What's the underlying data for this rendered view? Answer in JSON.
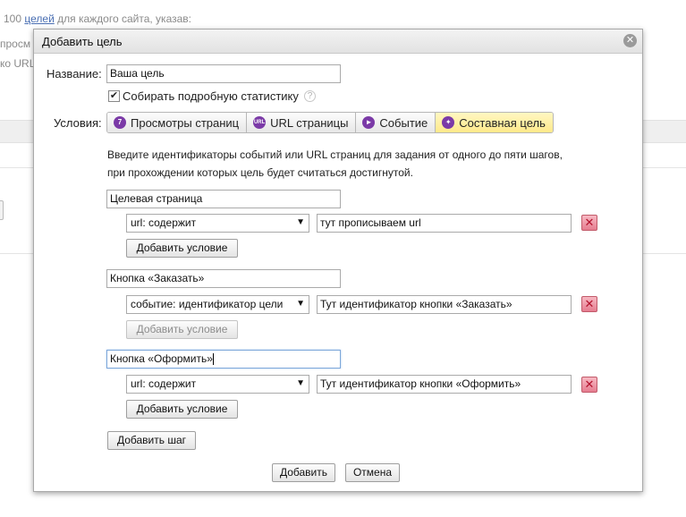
{
  "background": {
    "line1_prefix": "100",
    "line1_link": "целей",
    "line1_suffix": "для каждого сайта, указав:",
    "line2": "просм",
    "line3": "ко URL"
  },
  "dialog": {
    "title": "Добавить цель",
    "close_icon": "close-icon",
    "name_label": "Название:",
    "name_value": "Ваша цель",
    "detailed_stats_label": "Собирать подробную статистику",
    "detailed_stats_checked": true,
    "help_glyph": "?",
    "conditions_label": "Условия:",
    "tabs": [
      {
        "label": "Просмотры страниц",
        "icon": "pageviews-icon",
        "glyph": "7",
        "active": false
      },
      {
        "label": "URL страницы",
        "icon": "url-icon",
        "glyph": "URL",
        "active": false
      },
      {
        "label": "Событие",
        "icon": "event-icon",
        "glyph": "►",
        "active": false
      },
      {
        "label": "Составная цель",
        "icon": "composite-icon",
        "glyph": "✦",
        "active": true
      }
    ],
    "info_line1": "Введите идентификаторы событий или URL страниц для задания от одного до пяти шагов,",
    "info_line2": "при прохождении которых цель будет считаться достигнутой.",
    "steps": [
      {
        "name": "Целевая страница",
        "condition_type": "url: содержит",
        "condition_value": "тут прописываем url",
        "add_condition_label": "Добавить условие",
        "add_condition_disabled": false
      },
      {
        "name": "Кнопка «Заказать»",
        "condition_type": "событие: идентификатор цели",
        "condition_value": "Тут идентификатор кнопки «Заказать»",
        "add_condition_label": "Добавить условие",
        "add_condition_disabled": true
      },
      {
        "name": "Кнопка «Оформить»",
        "condition_type": "url: содержит",
        "condition_value": "Тут идентификатор кнопки «Оформить»",
        "add_condition_label": "Добавить условие",
        "add_condition_disabled": false
      }
    ],
    "delete_glyph": "✕",
    "select_arrow": "▼",
    "add_step_label": "Добавить шаг",
    "submit_label": "Добавить",
    "cancel_label": "Отмена"
  },
  "colors": {
    "active_tab": "#ffe98a",
    "tab_icon": "#7b3aa7",
    "delete_button": "#e57c8f",
    "link": "#4a6fb3"
  }
}
